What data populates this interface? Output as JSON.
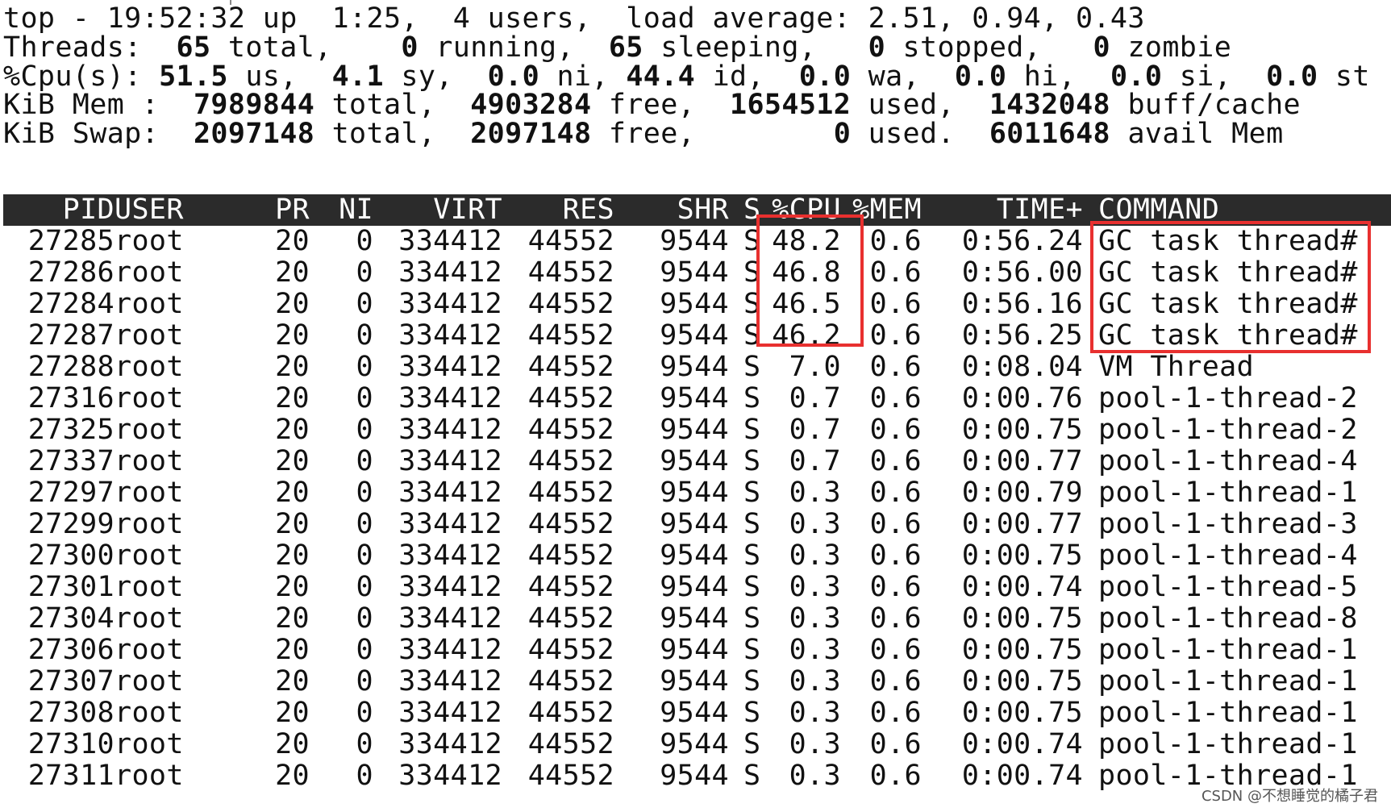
{
  "summary": {
    "top_line": "top - 19:52:32 up  1:25,  4 users,  load average: 2.51, 0.94, 0.43",
    "threads": {
      "label": "Threads: ",
      "total": " 65",
      "total_label": " total, ",
      "running": "   0",
      "running_label": " running, ",
      "sleeping": " 65",
      "sleeping_label": " sleeping, ",
      "stopped": "  0",
      "stopped_label": " stopped, ",
      "zombie": "  0",
      "zombie_label": " zombie"
    },
    "cpu": {
      "label": "%Cpu(s): ",
      "us": "51.5",
      "us_label": " us, ",
      "sy": " 4.1",
      "sy_label": " sy, ",
      "ni": " 0.0",
      "ni_label": " ni, ",
      "id": "44.4",
      "id_label": " id, ",
      "wa": " 0.0",
      "wa_label": " wa, ",
      "hi": " 0.0",
      "hi_label": " hi, ",
      "si": " 0.0",
      "si_label": " si, ",
      "st": " 0.0",
      "st_label": " st"
    },
    "mem": {
      "label": "KiB Mem : ",
      "total": " 7989844",
      "total_label": " total, ",
      "free": " 4903284",
      "free_label": " free, ",
      "used": " 1654512",
      "used_label": " used, ",
      "buff": " 1432048",
      "buff_label": " buff/cache"
    },
    "swap": {
      "label": "KiB Swap: ",
      "total": " 2097148",
      "total_label": " total, ",
      "free": " 2097148",
      "free_label": " free, ",
      "used": "       0",
      "used_label": " used. ",
      "avail": " 6011648",
      "avail_label": " avail Mem"
    }
  },
  "columns": [
    "PID",
    "USER",
    "PR",
    "NI",
    "VIRT",
    "RES",
    "SHR",
    "S",
    "%CPU",
    "%MEM",
    "TIME+",
    "COMMAND"
  ],
  "rows": [
    [
      "27285",
      "root",
      "20",
      "0",
      "334412",
      "44552",
      "9544",
      "S",
      "48.2",
      "0.6",
      "0:56.24",
      "GC task thread#"
    ],
    [
      "27286",
      "root",
      "20",
      "0",
      "334412",
      "44552",
      "9544",
      "S",
      "46.8",
      "0.6",
      "0:56.00",
      "GC task thread#"
    ],
    [
      "27284",
      "root",
      "20",
      "0",
      "334412",
      "44552",
      "9544",
      "S",
      "46.5",
      "0.6",
      "0:56.16",
      "GC task thread#"
    ],
    [
      "27287",
      "root",
      "20",
      "0",
      "334412",
      "44552",
      "9544",
      "S",
      "46.2",
      "0.6",
      "0:56.25",
      "GC task thread#"
    ],
    [
      "27288",
      "root",
      "20",
      "0",
      "334412",
      "44552",
      "9544",
      "S",
      "7.0",
      "0.6",
      "0:08.04",
      "VM Thread"
    ],
    [
      "27316",
      "root",
      "20",
      "0",
      "334412",
      "44552",
      "9544",
      "S",
      "0.7",
      "0.6",
      "0:00.76",
      "pool-1-thread-2"
    ],
    [
      "27325",
      "root",
      "20",
      "0",
      "334412",
      "44552",
      "9544",
      "S",
      "0.7",
      "0.6",
      "0:00.75",
      "pool-1-thread-2"
    ],
    [
      "27337",
      "root",
      "20",
      "0",
      "334412",
      "44552",
      "9544",
      "S",
      "0.7",
      "0.6",
      "0:00.77",
      "pool-1-thread-4"
    ],
    [
      "27297",
      "root",
      "20",
      "0",
      "334412",
      "44552",
      "9544",
      "S",
      "0.3",
      "0.6",
      "0:00.79",
      "pool-1-thread-1"
    ],
    [
      "27299",
      "root",
      "20",
      "0",
      "334412",
      "44552",
      "9544",
      "S",
      "0.3",
      "0.6",
      "0:00.77",
      "pool-1-thread-3"
    ],
    [
      "27300",
      "root",
      "20",
      "0",
      "334412",
      "44552",
      "9544",
      "S",
      "0.3",
      "0.6",
      "0:00.75",
      "pool-1-thread-4"
    ],
    [
      "27301",
      "root",
      "20",
      "0",
      "334412",
      "44552",
      "9544",
      "S",
      "0.3",
      "0.6",
      "0:00.74",
      "pool-1-thread-5"
    ],
    [
      "27304",
      "root",
      "20",
      "0",
      "334412",
      "44552",
      "9544",
      "S",
      "0.3",
      "0.6",
      "0:00.75",
      "pool-1-thread-8"
    ],
    [
      "27306",
      "root",
      "20",
      "0",
      "334412",
      "44552",
      "9544",
      "S",
      "0.3",
      "0.6",
      "0:00.75",
      "pool-1-thread-1"
    ],
    [
      "27307",
      "root",
      "20",
      "0",
      "334412",
      "44552",
      "9544",
      "S",
      "0.3",
      "0.6",
      "0:00.75",
      "pool-1-thread-1"
    ],
    [
      "27308",
      "root",
      "20",
      "0",
      "334412",
      "44552",
      "9544",
      "S",
      "0.3",
      "0.6",
      "0:00.75",
      "pool-1-thread-1"
    ],
    [
      "27310",
      "root",
      "20",
      "0",
      "334412",
      "44552",
      "9544",
      "S",
      "0.3",
      "0.6",
      "0:00.74",
      "pool-1-thread-1"
    ],
    [
      "27311",
      "root",
      "20",
      "0",
      "334412",
      "44552",
      "9544",
      "S",
      "0.3",
      "0.6",
      "0:00.74",
      "pool-1-thread-1"
    ]
  ],
  "watermark": "CSDN @不想睡觉的橘子君",
  "colors": {
    "header_bg": "#2b2b2b",
    "highlight": "#e8302f",
    "text": "#111111"
  }
}
